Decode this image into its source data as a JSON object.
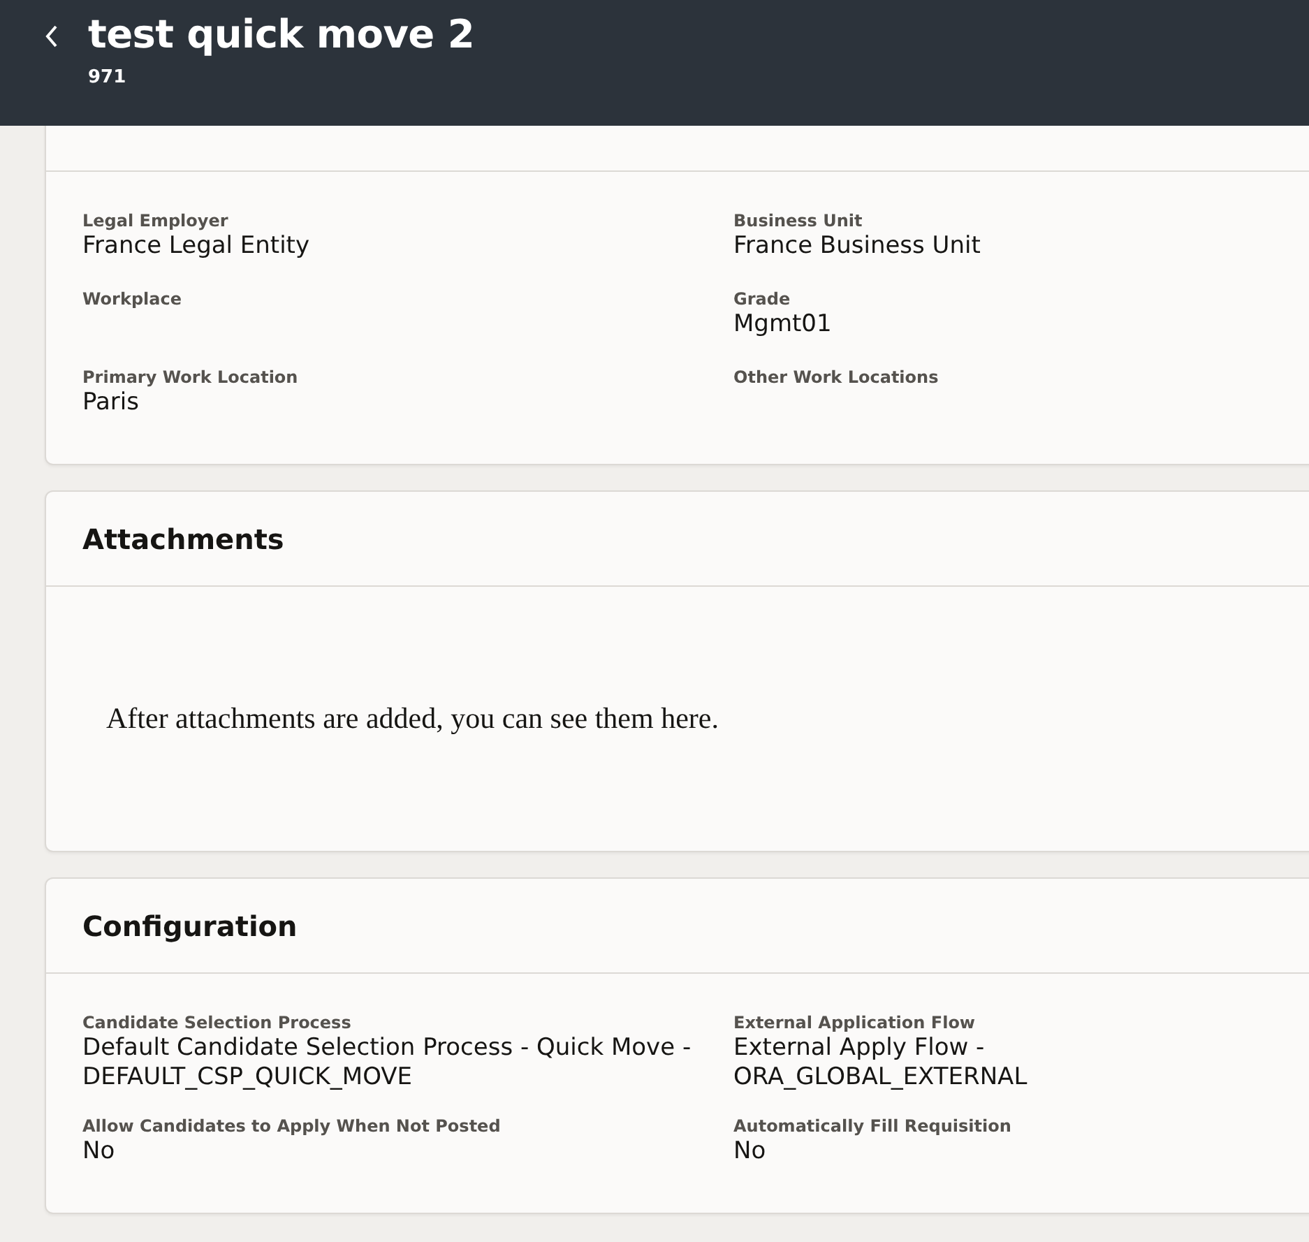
{
  "header": {
    "title": "test quick move 2",
    "subtitle": "971"
  },
  "sections": [
    {
      "kind": "fields",
      "fields": [
        {
          "label": "Legal Employer",
          "value": "France Legal Entity"
        },
        {
          "label": "Business Unit",
          "value": "France Business Unit"
        },
        {
          "label": "Workplace"
        },
        {
          "label": "Grade",
          "value": "Mgmt01"
        },
        {
          "label": "Primary Work Location",
          "value": "Paris"
        },
        {
          "label": "Other Work Locations"
        }
      ]
    },
    {
      "kind": "message",
      "title": "Attachments",
      "message": "After attachments are added, you can see them here."
    },
    {
      "kind": "fields",
      "title": "Configuration",
      "fields": [
        {
          "label": "Candidate Selection Process",
          "value": "Default Candidate Selection Process - Quick Move - DEFAULT_CSP_QUICK_MOVE"
        },
        {
          "label": "External Application Flow",
          "value": "External Apply Flow - ORA_GLOBAL_EXTERNAL"
        },
        {
          "label": "Allow Candidates to Apply When Not Posted",
          "value": "No"
        },
        {
          "label": "Automatically Fill Requisition",
          "value": "No"
        }
      ]
    }
  ]
}
